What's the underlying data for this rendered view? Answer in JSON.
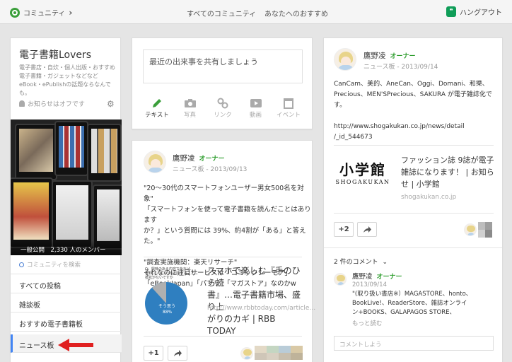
{
  "topbar": {
    "community": "コミュニティ",
    "nav_all": "すべてのコミュニティ",
    "nav_recommended": "あなたへのおすすめ",
    "hangout": "ハングアウト"
  },
  "community": {
    "title": "電子書籍Lovers",
    "description": "電子書店・自炊・個人出版・おすすめ電子書籍・ガジェットなどなど eBook・ePublishの話題ならなんでも。",
    "notify": "お知らせはオフです",
    "caption": "一般公開　2,330 人のメンバー",
    "search_placeholder": "コミュニティを検索",
    "categories": [
      "すべての投稿",
      "雑談板",
      "おすすめ電子書籍板",
      "ニュース板"
    ],
    "active_category": "ニュース板"
  },
  "share": {
    "placeholder": "最近の出来事を共有しましょう",
    "options": [
      "テキスト",
      "写真",
      "リンク",
      "動画",
      "イベント"
    ]
  },
  "post1": {
    "author": "鷹野凌",
    "role": "オーナー",
    "meta": "ニュース板 - 2013/09/13",
    "text_lines": [
      "\"20〜30代のスマートフォンユーザー男女500名を対象\"",
      "「スマートフォンを使って電子書籍を読んだことはあります",
      "か？」という質問には 39%、約4割が「ある」と答えた。\"",
      "",
      "\"調査実施機関：楽天リサーチ\"",
      "それなのに注目サービスは「コミックシーモア」",
      "「eBookJapan」「パブリ」「マガストア」なのかw"
    ],
    "link_title_lines": [
      "スマホで楽しむ『手のひら読",
      "書』…電子書籍市場、盛り上",
      "がりのカギ | RBB TODAY"
    ],
    "link_url": "http://www.rbbtoday.com/article...",
    "chart_question": "Q：興味のある内容であれば、有料コンテンツを利用することに抵抗がないですか",
    "chart_label": "そう思う",
    "chart_value": "88%",
    "plus_one": "+1"
  },
  "post2": {
    "author": "鷹野凌",
    "role": "オーナー",
    "meta": "ニュース板 - 2013/09/14",
    "text_lines": [
      "CanCam、美的、AneCan、Oggi、Domani、和樂、",
      "Precious、MEN'SPrecious、SAKURA が電子雑誌化で",
      "す。",
      "",
      "http://www.shogakukan.co.jp/news/detail",
      "/_id_544673"
    ],
    "logo_main": "小学館",
    "logo_sub": "SHOGAKUKAN",
    "link_title_lines": [
      "ファッション誌 9誌が電子",
      "雑誌になります！ | お知ら",
      "せ | 小学館"
    ],
    "link_url": "shogakukan.co.jp",
    "plus_count": "+2",
    "comments_count": "2 件のコメント",
    "comment": {
      "author": "鷹野凌",
      "role": "オーナー",
      "date": "2013/09/14",
      "lines": [
        "\"(取り扱い書店※）MAGASTORE、honto、",
        "BookLive!、ReaderStore、雑誌オンライ",
        "ン+BOOKS、GALAPAGOS STORE、"
      ],
      "more": "もっと読む"
    },
    "comment_placeholder": "コメントしよう"
  },
  "colors": {
    "accent": "#4285f4",
    "owner": "#2f9e2f",
    "arrow": "#e02020"
  }
}
